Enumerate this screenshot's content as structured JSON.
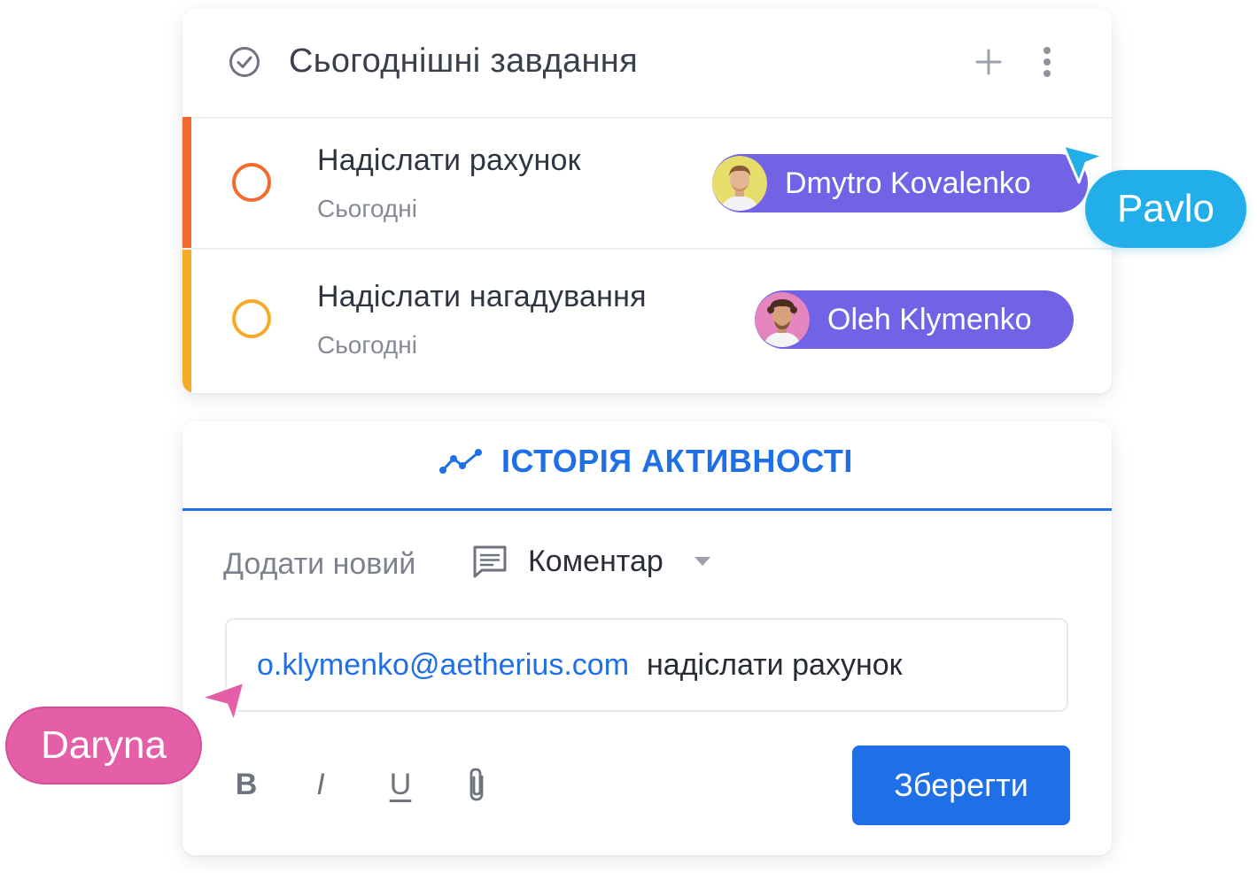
{
  "tasks_panel": {
    "title": "Сьогоднішні завдання",
    "tasks": [
      {
        "title": "Надіслати рахунок",
        "date": "Сьогодні",
        "priority_color": "#f26a2e",
        "assignee": "Dmytro Kovalenko"
      },
      {
        "title": "Надіслати нагадування",
        "date": "Сьогодні",
        "priority_color": "#f7a928",
        "assignee": "Oleh Klymenko"
      }
    ]
  },
  "activity_panel": {
    "tab_label": "ІСТОРІЯ АКТИВНОСТІ",
    "add_new_label": "Додати новий",
    "comment_type": "Коментар",
    "comment_input": {
      "mention": "o.klymenko@aetherius.com",
      "text": "надіслати рахунок"
    },
    "format_buttons": [
      "B",
      "I",
      "U"
    ],
    "save_label": "Зберегти"
  },
  "cursors": [
    {
      "name": "Pavlo",
      "color": "#22aee8"
    },
    {
      "name": "Daryna",
      "color": "#e45fa8"
    }
  ],
  "colors": {
    "accent": "#1f6fe6",
    "assignee_pill": "#7263e6"
  }
}
